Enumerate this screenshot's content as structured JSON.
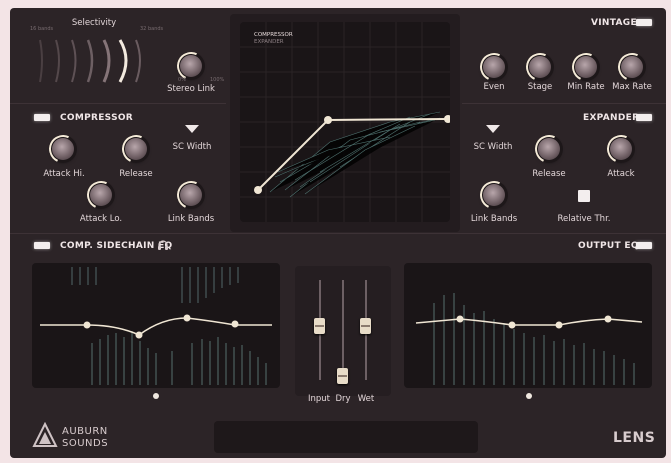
{
  "top_left": {
    "selectivity_label": "Selectivity",
    "sel_low": "16 bands",
    "sel_high": "32 bands",
    "stereo_link_label": "Stereo Link",
    "stereo_min": "0%",
    "stereo_max": "100%"
  },
  "compressor": {
    "title": "COMPRESSOR",
    "attack_hi": "Attack Hi.",
    "release": "Release",
    "sc_width": "SC Width",
    "attack_lo": "Attack Lo.",
    "link_bands": "Link Bands"
  },
  "display": {
    "mode1": "COMPRESSOR",
    "mode2": "EXPANDER"
  },
  "vintage": {
    "title": "VINTAGE",
    "even": "Even",
    "stage": "Stage",
    "min_rate": "Min Rate",
    "max_rate": "Max Rate"
  },
  "expander": {
    "title": "EXPANDER",
    "sc_width": "SC Width",
    "release": "Release",
    "attack": "Attack",
    "link_bands": "Link Bands",
    "relative_thr": "Relative Thr."
  },
  "sidechain_eq": {
    "title": "COMP. SIDECHAIN EQ"
  },
  "output_eq": {
    "title": "OUTPUT EQ"
  },
  "mixer": {
    "input": "Input",
    "dry": "Dry",
    "wet": "Wet"
  },
  "brand": {
    "line1": "AUBURN",
    "line2": "SOUNDS",
    "product": "LENS"
  },
  "icons": [
    "headphones-icon",
    "auburn-logo-icon"
  ],
  "colors": {
    "bg": "#2c2427",
    "panel": "#1a1517",
    "accent": "#f0e6d8",
    "text": "#e2d6d8"
  }
}
